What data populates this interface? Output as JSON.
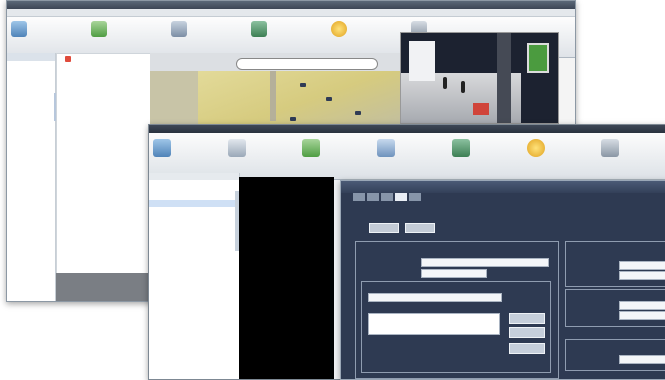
{
  "back_window": {
    "title": "",
    "menu": [
      "",
      "",
      "",
      "",
      ""
    ],
    "ribbon": [
      {
        "icon": "camera-icon",
        "label": ""
      },
      {
        "icon": "monitor-icon",
        "label": ""
      },
      {
        "icon": "map-icon",
        "label": ""
      },
      {
        "icon": "report-icon",
        "label": ""
      },
      {
        "icon": "alarm-icon",
        "label": ""
      },
      {
        "icon": "settings-icon",
        "label": ""
      }
    ],
    "tree_header": "",
    "tree_items": [
      "",
      "",
      "",
      "",
      "",
      "",
      "",
      "",
      "",
      "",
      "",
      "",
      "",
      "",
      "",
      "",
      "",
      "",
      "",
      "",
      "",
      "",
      "",
      "",
      "",
      "",
      ""
    ],
    "map_label": ""
  },
  "middle_window": {
    "menu": [
      "",
      "",
      "",
      "",
      "",
      ""
    ],
    "ribbon": [
      {
        "icon": "camera-icon",
        "label": ""
      },
      {
        "icon": "monitor-icon",
        "label": ""
      },
      {
        "icon": "map-icon",
        "label": ""
      },
      {
        "icon": "report-icon",
        "label": ""
      },
      {
        "icon": "schedule-icon",
        "label": ""
      },
      {
        "icon": "alarm-icon",
        "label": ""
      },
      {
        "icon": "tools-icon",
        "label": ""
      }
    ],
    "tree_header": "",
    "tree_items": [
      "",
      "",
      "",
      "",
      "",
      "",
      "",
      "",
      "",
      "",
      "",
      "",
      "",
      "",
      "",
      "",
      "",
      "",
      "",
      "",
      "",
      "",
      "",
      "",
      "",
      "",
      "",
      "",
      "",
      "",
      ""
    ]
  },
  "dialog": {
    "title": "",
    "tabs": [
      "",
      "",
      "",
      "",
      ""
    ],
    "buttons": [
      "",
      ""
    ],
    "group_left": "",
    "group_right_1": "",
    "group_right_2": "",
    "group_right_3": "",
    "field_rows": [
      {
        "label": "",
        "value": ""
      },
      {
        "label": "",
        "value": ""
      }
    ],
    "list_items": [
      "",
      ""
    ],
    "side_buttons": [
      "",
      "",
      ""
    ],
    "right_fields": [
      {
        "label": "",
        "value": ""
      },
      {
        "label": "",
        "value": ""
      },
      {
        "label": "",
        "value": ""
      },
      {
        "label": "",
        "value": ""
      },
      {
        "label": "",
        "value": ""
      }
    ]
  },
  "colors": {
    "dialog_bg": "#2e3a52",
    "ribbon_bg": "#dde2e7",
    "map_floor": "#d6cb7f"
  }
}
